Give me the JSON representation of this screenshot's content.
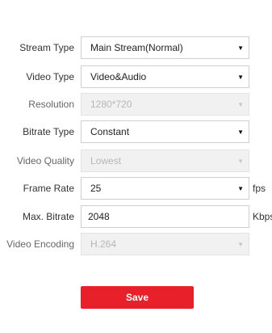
{
  "form": {
    "stream_type": {
      "label": "Stream Type",
      "value": "Main Stream(Normal)",
      "enabled": true
    },
    "video_type": {
      "label": "Video Type",
      "value": "Video&Audio",
      "enabled": true
    },
    "resolution": {
      "label": "Resolution",
      "value": "1280*720",
      "enabled": false
    },
    "bitrate_type": {
      "label": "Bitrate Type",
      "value": "Constant",
      "enabled": true
    },
    "video_quality": {
      "label": "Video Quality",
      "value": "Lowest",
      "enabled": false
    },
    "frame_rate": {
      "label": "Frame Rate",
      "value": "25",
      "unit": "fps",
      "enabled": true
    },
    "max_bitrate": {
      "label": "Max. Bitrate",
      "value": "2048",
      "unit": "Kbps",
      "enabled": true
    },
    "video_encoding": {
      "label": "Video Encoding",
      "value": "H.264",
      "enabled": false
    }
  },
  "icons": {
    "dropdown": "chevron-down-icon"
  },
  "caret_glyph": "▼",
  "save_label": "Save",
  "colors": {
    "save_button": "#e8202a",
    "disabled_field": "#f1f1f1",
    "border": "#cfcfcf"
  }
}
